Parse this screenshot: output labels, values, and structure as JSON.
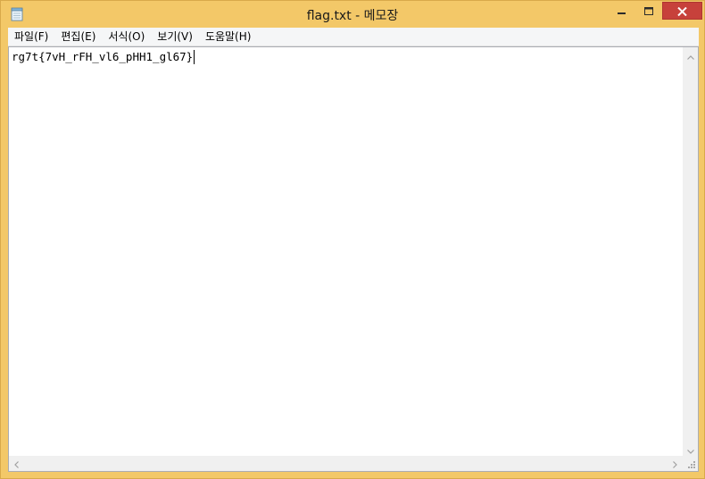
{
  "window": {
    "title": "flag.txt - 메모장",
    "app_icon": "notepad-icon"
  },
  "title_buttons": {
    "minimize_icon": "minimize-icon",
    "maximize_icon": "maximize-icon",
    "close_icon": "close-icon"
  },
  "menu": {
    "items": [
      {
        "label": "파일(F)"
      },
      {
        "label": "편집(E)"
      },
      {
        "label": "서식(O)"
      },
      {
        "label": "보기(V)"
      },
      {
        "label": "도움말(H)"
      }
    ]
  },
  "editor": {
    "text": "rg7t{7vH_rFH_vl6_pHH1_gl67}"
  },
  "colors": {
    "window_frame": "#f3c868",
    "close_button": "#c7413b",
    "editor_bg": "#ffffff",
    "menubar_bg": "#f5f6f7"
  }
}
